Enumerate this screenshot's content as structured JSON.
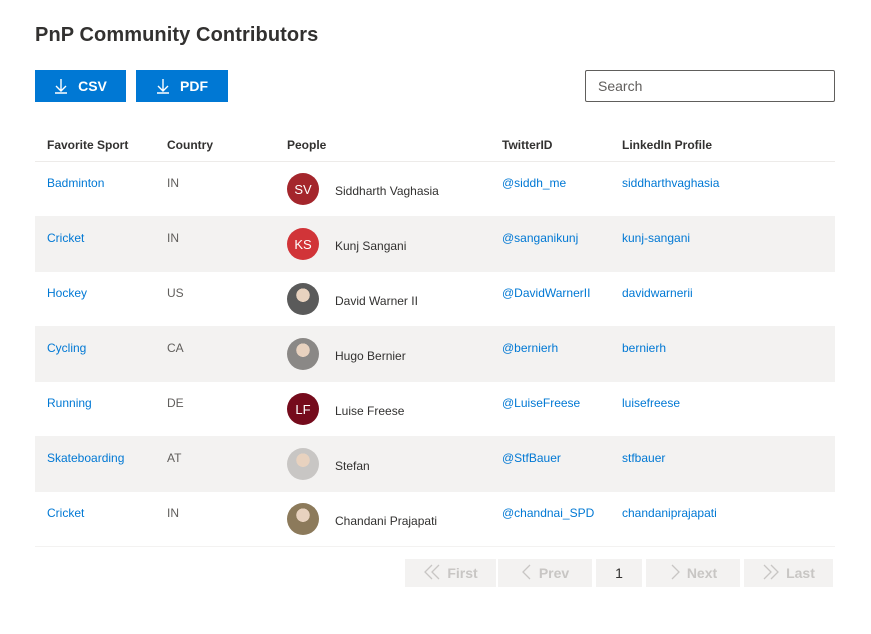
{
  "title": "PnP Community Contributors",
  "toolbar": {
    "csv_label": "CSV",
    "pdf_label": "PDF",
    "search_placeholder": "Search"
  },
  "columns": [
    "Favorite Sport",
    "Country",
    "People",
    "TwitterID",
    "LinkedIn Profile"
  ],
  "rows": [
    {
      "sport": "Badminton",
      "country": "IN",
      "person": "Siddharth Vaghasia",
      "initials": "SV",
      "avatar_color": "#a4262c",
      "photo": false,
      "twitter": "@siddh_me",
      "linkedin": "siddharthvaghasia"
    },
    {
      "sport": "Cricket",
      "country": "IN",
      "person": "Kunj Sangani",
      "initials": "KS",
      "avatar_color": "#d13438",
      "photo": false,
      "twitter": "@sanganikunj",
      "linkedin": "kunj-sangani"
    },
    {
      "sport": "Hockey",
      "country": "US",
      "person": "David Warner II",
      "initials": "",
      "avatar_color": "#5a5a5a",
      "photo": true,
      "twitter": "@DavidWarnerII",
      "linkedin": "davidwarnerii"
    },
    {
      "sport": "Cycling",
      "country": "CA",
      "person": "Hugo Bernier",
      "initials": "",
      "avatar_color": "#8a8886",
      "photo": true,
      "twitter": "@bernierh",
      "linkedin": "bernierh"
    },
    {
      "sport": "Running",
      "country": "DE",
      "person": "Luise Freese",
      "initials": "LF",
      "avatar_color": "#750b1c",
      "photo": false,
      "twitter": "@LuiseFreese",
      "linkedin": "luisefreese"
    },
    {
      "sport": "Skateboarding",
      "country": "AT",
      "person": "Stefan",
      "initials": "",
      "avatar_color": "#c8c6c4",
      "photo": true,
      "twitter": "@StfBauer",
      "linkedin": "stfbauer"
    },
    {
      "sport": "Cricket",
      "country": "IN",
      "person": "Chandani Prajapati",
      "initials": "",
      "avatar_color": "#8c7a5b",
      "photo": true,
      "twitter": "@chandnai_SPD",
      "linkedin": "chandaniprajapati"
    }
  ],
  "pagination": {
    "first_label": "First",
    "prev_label": "Prev",
    "current_page": "1",
    "next_label": "Next",
    "last_label": "Last"
  }
}
